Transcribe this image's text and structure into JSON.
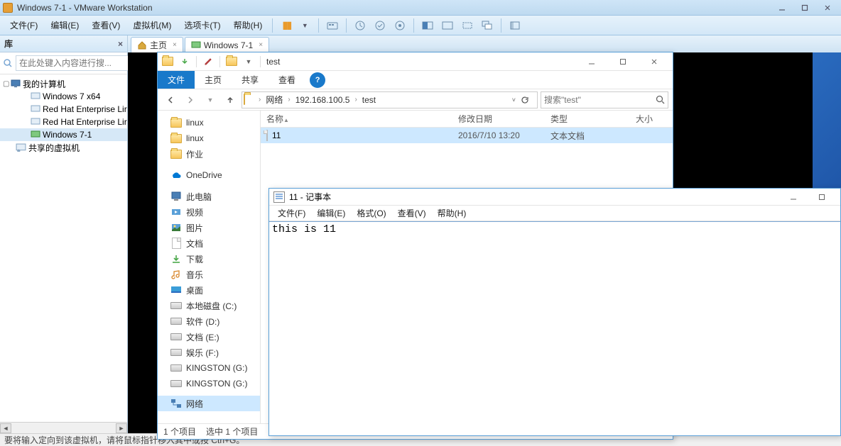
{
  "vmware": {
    "title": "Windows 7-1 - VMware Workstation",
    "menus": [
      "文件(F)",
      "编辑(E)",
      "查看(V)",
      "虚拟机(M)",
      "选项卡(T)",
      "帮助(H)"
    ],
    "library": {
      "header": "库",
      "search_placeholder": "在此处键入内容进行搜...",
      "root": "我的计算机",
      "vms": [
        "Windows 7 x64",
        "Red Hat Enterprise Lir",
        "Red Hat Enterprise Lir",
        "Windows 7-1"
      ],
      "shared": "共享的虚拟机"
    },
    "tabs": {
      "home": "主页",
      "vm": "Windows 7-1"
    },
    "status": "要将输入定向到该虚拟机，请将鼠标指针移入其中或按 Ctrl+G。"
  },
  "explorer": {
    "title": "test",
    "ribbon": {
      "file": "文件",
      "home": "主页",
      "share": "共享",
      "view": "查看"
    },
    "address": {
      "crumbs": [
        "网络",
        "192.168.100.5",
        "test"
      ],
      "search_placeholder": "搜索\"test\""
    },
    "nav": {
      "items_top": [
        "linux",
        "linux",
        "作业"
      ],
      "onedrive": "OneDrive",
      "thispc": "此电脑",
      "folders": [
        "视频",
        "图片",
        "文档",
        "下载",
        "音乐",
        "桌面"
      ],
      "drives": [
        "本地磁盘 (C:)",
        "软件 (D:)",
        "文档 (E:)",
        "娱乐 (F:)",
        "KINGSTON (G:)",
        "KINGSTON (G:)"
      ],
      "network": "网络"
    },
    "columns": {
      "name": "名称",
      "date": "修改日期",
      "type": "类型",
      "size": "大小"
    },
    "files": [
      {
        "name": "11",
        "date": "2016/7/10 13:20",
        "type": "文本文档",
        "size": ""
      }
    ],
    "status": {
      "count": "1 个项目",
      "selected": "选中 1 个项目"
    }
  },
  "notepad": {
    "title": "11 - 记事本",
    "menus": [
      "文件(F)",
      "编辑(E)",
      "格式(O)",
      "查看(V)",
      "帮助(H)"
    ],
    "content": "this is 11"
  }
}
